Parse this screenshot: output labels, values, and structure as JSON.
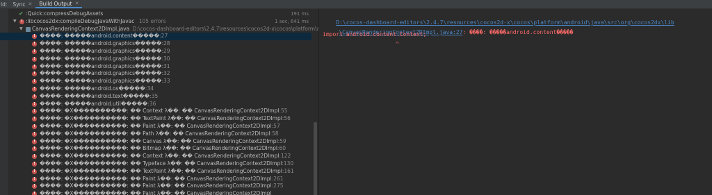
{
  "toolbar": {
    "build_label": "ld:",
    "tabs": [
      {
        "label": "Sync"
      },
      {
        "label": "Build Output"
      }
    ]
  },
  "tree": {
    "rows": [
      {
        "text": ":Quick:compressDebugAssets",
        "duration": "191 ms"
      },
      {
        "text": ":libcocos2dx:compileDebugJavaWithJavac",
        "extra": "105 errors",
        "duration": "1 sec, 641 ms"
      },
      {
        "file": "CanvasRenderingContext2DImpl.java",
        "path": "D:\\cocos-dashboard-editors\\2.4.7\\resources\\cocos2d-x\\cocos\\platform\\android\\java\\src"
      },
      {
        "msg": "����: �����android.content�����",
        "ln": ":27"
      },
      {
        "msg": "����: �����android.graphics�����",
        "ln": ":28"
      },
      {
        "msg": "����: �����android.graphics�����",
        "ln": ":29"
      },
      {
        "msg": "����: �����android.graphics�����",
        "ln": ":30"
      },
      {
        "msg": "����: �����android.graphics�����",
        "ln": ":31"
      },
      {
        "msg": "����: �����android.graphics�����",
        "ln": ":32"
      },
      {
        "msg": "����: �����android.graphics�����",
        "ln": ":33"
      },
      {
        "msg": "����: �����android.os�����",
        "ln": ":34"
      },
      {
        "msg": "����: �����android.text�����",
        "ln": ":35"
      },
      {
        "msg": "����: �����android.util�����",
        "ln": ":36"
      },
      {
        "msg": "����: �X����������: �� Context λ��: �� CanvasRenderingContext2DImpl",
        "ln": ":55"
      },
      {
        "msg": "����: �X����������: �� TextPaint λ��: �� CanvasRenderingContext2DImpl",
        "ln": ":56"
      },
      {
        "msg": "����: �X����������: �� Paint λ��: �� CanvasRenderingContext2DImpl",
        "ln": ":57"
      },
      {
        "msg": "����: �X����������: �� Path λ��: �� CanvasRenderingContext2DImpl",
        "ln": ":58"
      },
      {
        "msg": "����: �X����������: �� Canvas λ��: �� CanvasRenderingContext2DImpl",
        "ln": ":59"
      },
      {
        "msg": "����: �X����������: �� Bitmap λ��: �� CanvasRenderingContext2DImpl",
        "ln": ":60"
      },
      {
        "msg": "����: �X����������: �� Context λ��: �� CanvasRenderingContext2DImpl",
        "ln": ":122"
      },
      {
        "msg": "����: �X����������: �� Typeface λ��: �� CanvasRenderingContext2DImpl",
        "ln": ":130"
      },
      {
        "msg": "����: �X����������: �� TextPaint λ��: �� CanvasRenderingContext2DImpl",
        "ln": ":161"
      },
      {
        "msg": "����: �X����������: �� Paint λ��: �� CanvasRenderingContext2DImpl",
        "ln": ":261"
      },
      {
        "msg": "����: �X����������: �� Paint λ��: �� CanvasRenderingContext2DImpl",
        "ln": ":275"
      },
      {
        "msg": "����: �X����������: �� Paint λ��: �� CanvasRenderingContext2DImpl",
        "ln": ""
      }
    ]
  },
  "detail": {
    "path_line1": "D:\\cocos-dashboard-editors\\2.4.7\\resources\\cocos2d-x\\cocos\\platform\\android\\java\\src\\org\\cocos2dx\\lib",
    "path_line2": "\\CanvasRenderingContext2DImpl.java:27",
    "msg_after": ": ����: �����android.content�����",
    "code": "import android.content.Context;",
    "caret": "^"
  },
  "colors": {
    "error": "#c75450",
    "link": "#4a88c7",
    "error_text": "#ff6b68",
    "selected_row": "#0d293e"
  },
  "icons": {
    "success": "check-icon",
    "error": "error-icon",
    "expand": "chevron-down-icon",
    "file": "java-file-icon",
    "close": "close-icon"
  }
}
